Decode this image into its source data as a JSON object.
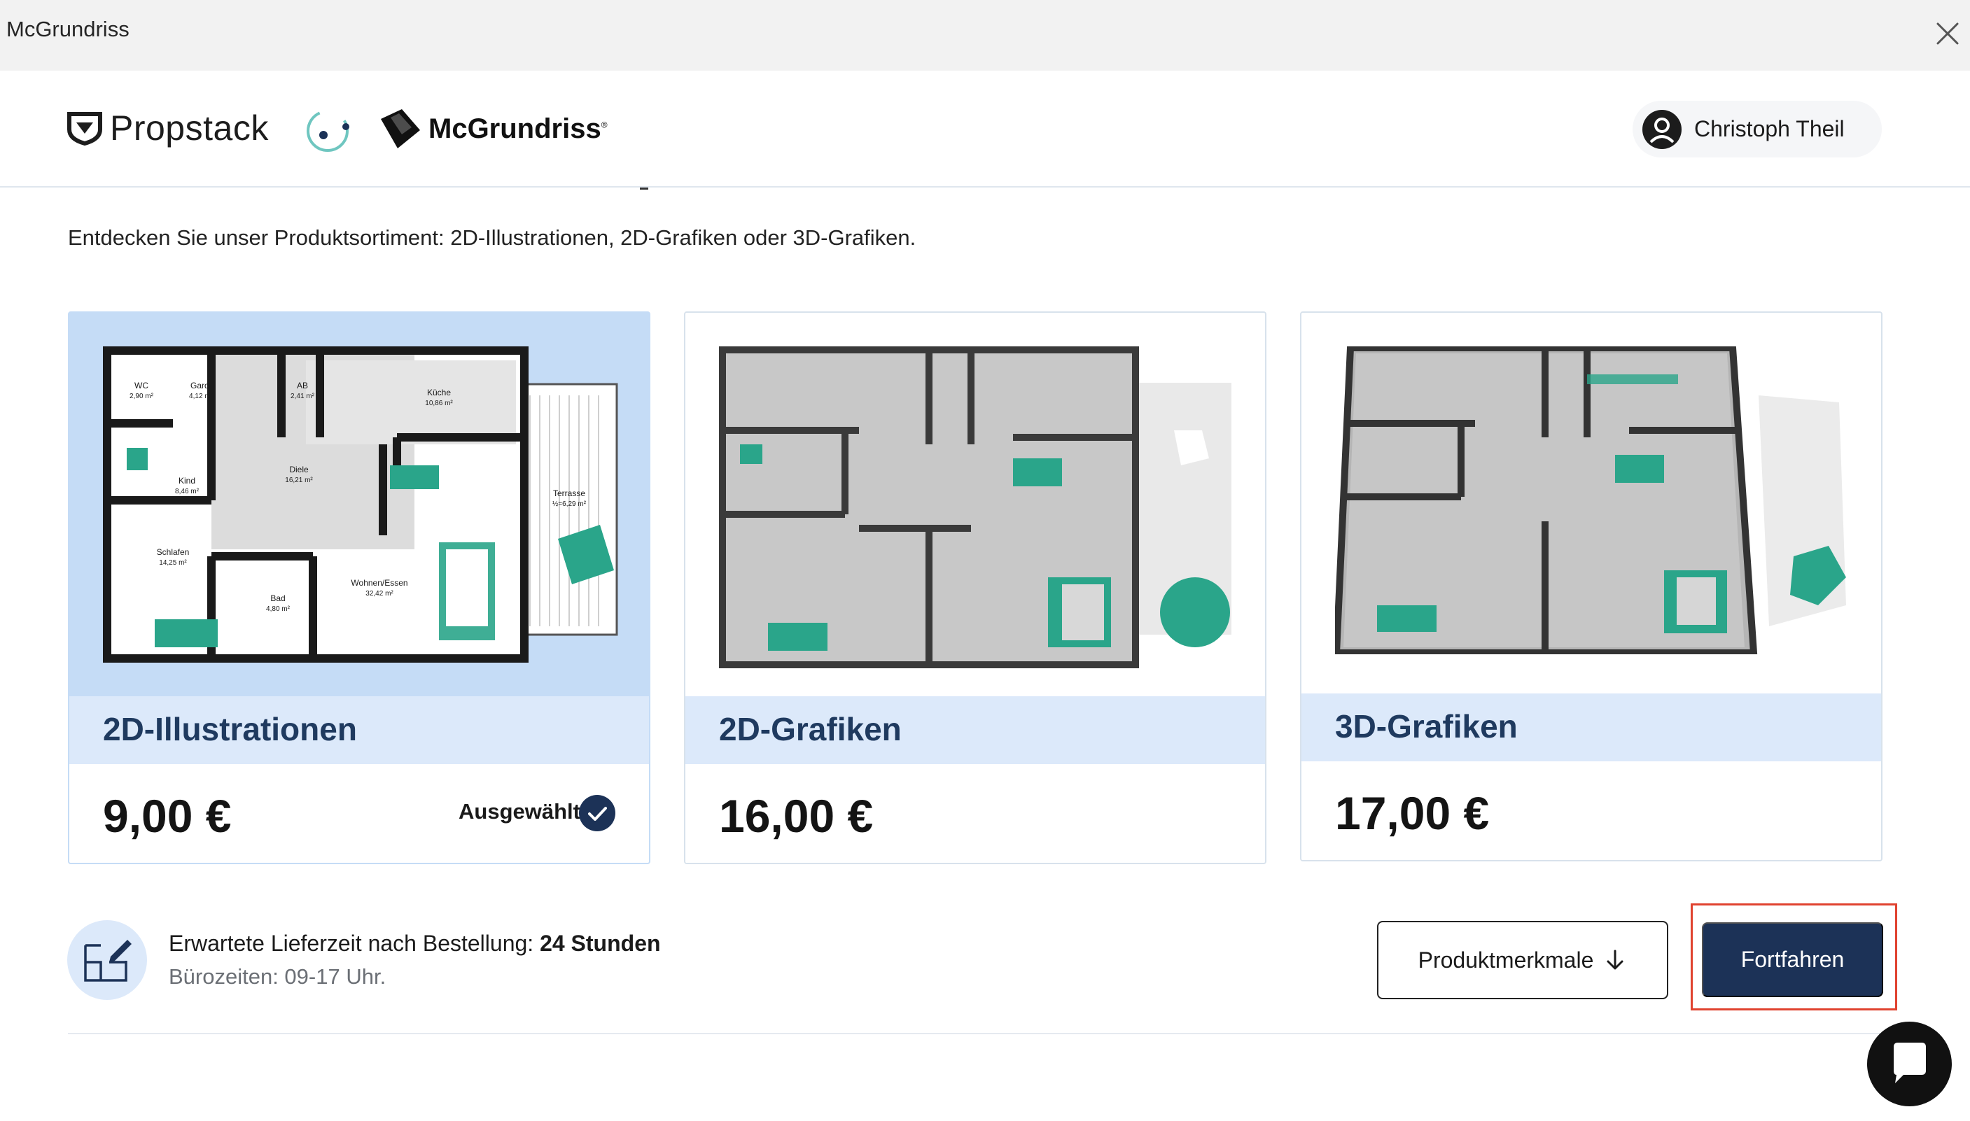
{
  "window": {
    "title": "McGrundriss"
  },
  "header": {
    "brand_left": "Propstack",
    "brand_right": "McGrundriss",
    "brand_right_mark": "®",
    "user_name": "Christoph Theil"
  },
  "intro": "Entdecken Sie unser Produktsortiment: 2D-Illustrationen, 2D-Grafiken oder 3D-Grafiken.",
  "products": [
    {
      "name": "2D-Illustrationen",
      "price": "9,00 €",
      "selected": true,
      "selected_label": "Ausgewählt",
      "rooms": [
        {
          "name": "WC",
          "area": "2,90 m²"
        },
        {
          "name": "Gard.",
          "area": "4,12 m²"
        },
        {
          "name": "AB",
          "area": "2,41 m²"
        },
        {
          "name": "Küche",
          "area": "10,86 m²"
        },
        {
          "name": "Diele",
          "area": "16,21 m²"
        },
        {
          "name": "Kind",
          "area": "8,46 m²"
        },
        {
          "name": "Terrasse",
          "area": "½=6,29 m²"
        },
        {
          "name": "Schlafen",
          "area": "14,25 m²"
        },
        {
          "name": "Bad",
          "area": "4,80 m²"
        },
        {
          "name": "Wohnen/Essen",
          "area": "32,42 m²"
        }
      ]
    },
    {
      "name": "2D-Grafiken",
      "price": "16,00 €",
      "selected": false
    },
    {
      "name": "3D-Grafiken",
      "price": "17,00 €",
      "selected": false
    }
  ],
  "delivery": {
    "line1_prefix": "Erwartete Lieferzeit nach Bestellung:",
    "line1_bold": "24 Stunden",
    "line2": "Bürozeiten: 09-17 Uhr."
  },
  "actions": {
    "features_label": "Produktmerkmale",
    "continue_label": "Fortfahren"
  },
  "colors": {
    "navy": "#1c3257",
    "selected_card_bg": "#c5dcf6",
    "name_band": "#dce9fa",
    "teal_accent": "#2aa58a",
    "highlight_outline": "#e0422f"
  },
  "icons": [
    "close-icon",
    "propstack-logo-icon",
    "circle-logo-icon",
    "mcgrundriss-logo-icon",
    "user-avatar-icon",
    "checkmark-icon",
    "floorplan-edit-icon",
    "arrow-down-icon",
    "chat-icon"
  ]
}
